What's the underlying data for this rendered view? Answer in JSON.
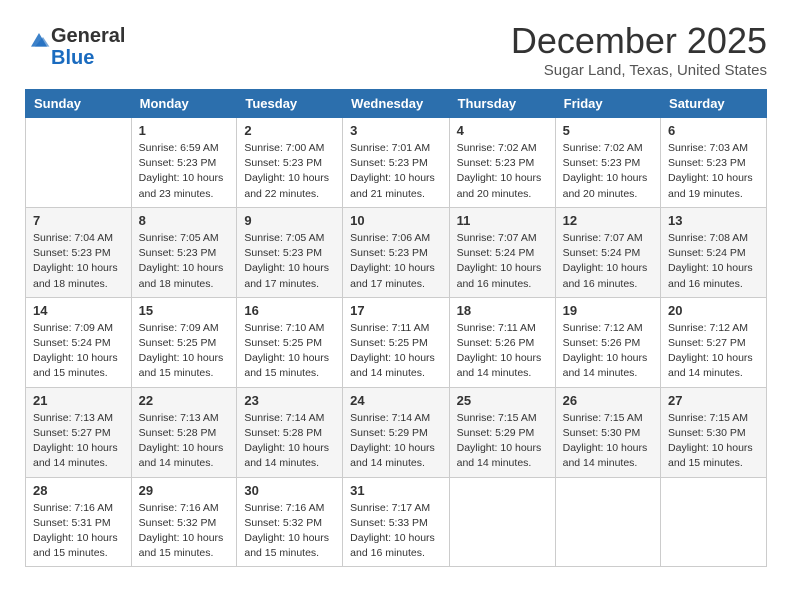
{
  "logo": {
    "general": "General",
    "blue": "Blue"
  },
  "title": "December 2025",
  "location": "Sugar Land, Texas, United States",
  "days_of_week": [
    "Sunday",
    "Monday",
    "Tuesday",
    "Wednesday",
    "Thursday",
    "Friday",
    "Saturday"
  ],
  "weeks": [
    [
      {
        "day": "",
        "sunrise": "",
        "sunset": "",
        "daylight": ""
      },
      {
        "day": "1",
        "sunrise": "Sunrise: 6:59 AM",
        "sunset": "Sunset: 5:23 PM",
        "daylight": "Daylight: 10 hours and 23 minutes."
      },
      {
        "day": "2",
        "sunrise": "Sunrise: 7:00 AM",
        "sunset": "Sunset: 5:23 PM",
        "daylight": "Daylight: 10 hours and 22 minutes."
      },
      {
        "day": "3",
        "sunrise": "Sunrise: 7:01 AM",
        "sunset": "Sunset: 5:23 PM",
        "daylight": "Daylight: 10 hours and 21 minutes."
      },
      {
        "day": "4",
        "sunrise": "Sunrise: 7:02 AM",
        "sunset": "Sunset: 5:23 PM",
        "daylight": "Daylight: 10 hours and 20 minutes."
      },
      {
        "day": "5",
        "sunrise": "Sunrise: 7:02 AM",
        "sunset": "Sunset: 5:23 PM",
        "daylight": "Daylight: 10 hours and 20 minutes."
      },
      {
        "day": "6",
        "sunrise": "Sunrise: 7:03 AM",
        "sunset": "Sunset: 5:23 PM",
        "daylight": "Daylight: 10 hours and 19 minutes."
      }
    ],
    [
      {
        "day": "7",
        "sunrise": "Sunrise: 7:04 AM",
        "sunset": "Sunset: 5:23 PM",
        "daylight": "Daylight: 10 hours and 18 minutes."
      },
      {
        "day": "8",
        "sunrise": "Sunrise: 7:05 AM",
        "sunset": "Sunset: 5:23 PM",
        "daylight": "Daylight: 10 hours and 18 minutes."
      },
      {
        "day": "9",
        "sunrise": "Sunrise: 7:05 AM",
        "sunset": "Sunset: 5:23 PM",
        "daylight": "Daylight: 10 hours and 17 minutes."
      },
      {
        "day": "10",
        "sunrise": "Sunrise: 7:06 AM",
        "sunset": "Sunset: 5:23 PM",
        "daylight": "Daylight: 10 hours and 17 minutes."
      },
      {
        "day": "11",
        "sunrise": "Sunrise: 7:07 AM",
        "sunset": "Sunset: 5:24 PM",
        "daylight": "Daylight: 10 hours and 16 minutes."
      },
      {
        "day": "12",
        "sunrise": "Sunrise: 7:07 AM",
        "sunset": "Sunset: 5:24 PM",
        "daylight": "Daylight: 10 hours and 16 minutes."
      },
      {
        "day": "13",
        "sunrise": "Sunrise: 7:08 AM",
        "sunset": "Sunset: 5:24 PM",
        "daylight": "Daylight: 10 hours and 16 minutes."
      }
    ],
    [
      {
        "day": "14",
        "sunrise": "Sunrise: 7:09 AM",
        "sunset": "Sunset: 5:24 PM",
        "daylight": "Daylight: 10 hours and 15 minutes."
      },
      {
        "day": "15",
        "sunrise": "Sunrise: 7:09 AM",
        "sunset": "Sunset: 5:25 PM",
        "daylight": "Daylight: 10 hours and 15 minutes."
      },
      {
        "day": "16",
        "sunrise": "Sunrise: 7:10 AM",
        "sunset": "Sunset: 5:25 PM",
        "daylight": "Daylight: 10 hours and 15 minutes."
      },
      {
        "day": "17",
        "sunrise": "Sunrise: 7:11 AM",
        "sunset": "Sunset: 5:25 PM",
        "daylight": "Daylight: 10 hours and 14 minutes."
      },
      {
        "day": "18",
        "sunrise": "Sunrise: 7:11 AM",
        "sunset": "Sunset: 5:26 PM",
        "daylight": "Daylight: 10 hours and 14 minutes."
      },
      {
        "day": "19",
        "sunrise": "Sunrise: 7:12 AM",
        "sunset": "Sunset: 5:26 PM",
        "daylight": "Daylight: 10 hours and 14 minutes."
      },
      {
        "day": "20",
        "sunrise": "Sunrise: 7:12 AM",
        "sunset": "Sunset: 5:27 PM",
        "daylight": "Daylight: 10 hours and 14 minutes."
      }
    ],
    [
      {
        "day": "21",
        "sunrise": "Sunrise: 7:13 AM",
        "sunset": "Sunset: 5:27 PM",
        "daylight": "Daylight: 10 hours and 14 minutes."
      },
      {
        "day": "22",
        "sunrise": "Sunrise: 7:13 AM",
        "sunset": "Sunset: 5:28 PM",
        "daylight": "Daylight: 10 hours and 14 minutes."
      },
      {
        "day": "23",
        "sunrise": "Sunrise: 7:14 AM",
        "sunset": "Sunset: 5:28 PM",
        "daylight": "Daylight: 10 hours and 14 minutes."
      },
      {
        "day": "24",
        "sunrise": "Sunrise: 7:14 AM",
        "sunset": "Sunset: 5:29 PM",
        "daylight": "Daylight: 10 hours and 14 minutes."
      },
      {
        "day": "25",
        "sunrise": "Sunrise: 7:15 AM",
        "sunset": "Sunset: 5:29 PM",
        "daylight": "Daylight: 10 hours and 14 minutes."
      },
      {
        "day": "26",
        "sunrise": "Sunrise: 7:15 AM",
        "sunset": "Sunset: 5:30 PM",
        "daylight": "Daylight: 10 hours and 14 minutes."
      },
      {
        "day": "27",
        "sunrise": "Sunrise: 7:15 AM",
        "sunset": "Sunset: 5:30 PM",
        "daylight": "Daylight: 10 hours and 15 minutes."
      }
    ],
    [
      {
        "day": "28",
        "sunrise": "Sunrise: 7:16 AM",
        "sunset": "Sunset: 5:31 PM",
        "daylight": "Daylight: 10 hours and 15 minutes."
      },
      {
        "day": "29",
        "sunrise": "Sunrise: 7:16 AM",
        "sunset": "Sunset: 5:32 PM",
        "daylight": "Daylight: 10 hours and 15 minutes."
      },
      {
        "day": "30",
        "sunrise": "Sunrise: 7:16 AM",
        "sunset": "Sunset: 5:32 PM",
        "daylight": "Daylight: 10 hours and 15 minutes."
      },
      {
        "day": "31",
        "sunrise": "Sunrise: 7:17 AM",
        "sunset": "Sunset: 5:33 PM",
        "daylight": "Daylight: 10 hours and 16 minutes."
      },
      {
        "day": "",
        "sunrise": "",
        "sunset": "",
        "daylight": ""
      },
      {
        "day": "",
        "sunrise": "",
        "sunset": "",
        "daylight": ""
      },
      {
        "day": "",
        "sunrise": "",
        "sunset": "",
        "daylight": ""
      }
    ]
  ]
}
